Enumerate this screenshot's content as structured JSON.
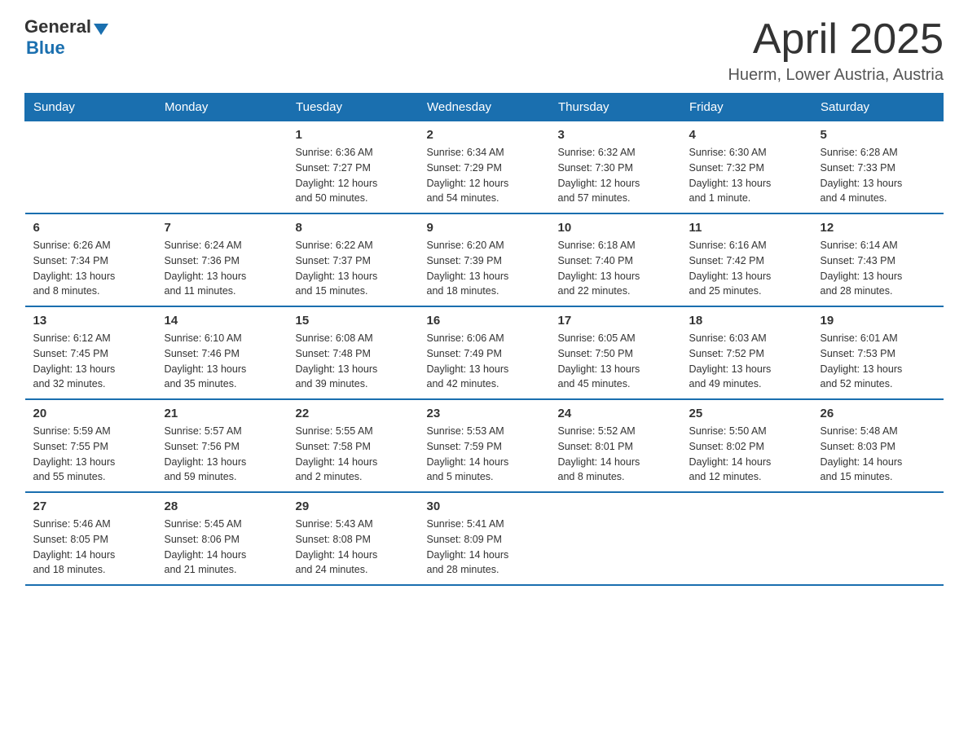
{
  "header": {
    "logo": {
      "general": "General",
      "blue": "Blue",
      "triangle_color": "#1a6faf"
    },
    "title": "April 2025",
    "subtitle": "Huerm, Lower Austria, Austria"
  },
  "calendar": {
    "weekdays": [
      "Sunday",
      "Monday",
      "Tuesday",
      "Wednesday",
      "Thursday",
      "Friday",
      "Saturday"
    ],
    "weeks": [
      [
        {
          "day": "",
          "info": ""
        },
        {
          "day": "",
          "info": ""
        },
        {
          "day": "1",
          "info": "Sunrise: 6:36 AM\nSunset: 7:27 PM\nDaylight: 12 hours\nand 50 minutes."
        },
        {
          "day": "2",
          "info": "Sunrise: 6:34 AM\nSunset: 7:29 PM\nDaylight: 12 hours\nand 54 minutes."
        },
        {
          "day": "3",
          "info": "Sunrise: 6:32 AM\nSunset: 7:30 PM\nDaylight: 12 hours\nand 57 minutes."
        },
        {
          "day": "4",
          "info": "Sunrise: 6:30 AM\nSunset: 7:32 PM\nDaylight: 13 hours\nand 1 minute."
        },
        {
          "day": "5",
          "info": "Sunrise: 6:28 AM\nSunset: 7:33 PM\nDaylight: 13 hours\nand 4 minutes."
        }
      ],
      [
        {
          "day": "6",
          "info": "Sunrise: 6:26 AM\nSunset: 7:34 PM\nDaylight: 13 hours\nand 8 minutes."
        },
        {
          "day": "7",
          "info": "Sunrise: 6:24 AM\nSunset: 7:36 PM\nDaylight: 13 hours\nand 11 minutes."
        },
        {
          "day": "8",
          "info": "Sunrise: 6:22 AM\nSunset: 7:37 PM\nDaylight: 13 hours\nand 15 minutes."
        },
        {
          "day": "9",
          "info": "Sunrise: 6:20 AM\nSunset: 7:39 PM\nDaylight: 13 hours\nand 18 minutes."
        },
        {
          "day": "10",
          "info": "Sunrise: 6:18 AM\nSunset: 7:40 PM\nDaylight: 13 hours\nand 22 minutes."
        },
        {
          "day": "11",
          "info": "Sunrise: 6:16 AM\nSunset: 7:42 PM\nDaylight: 13 hours\nand 25 minutes."
        },
        {
          "day": "12",
          "info": "Sunrise: 6:14 AM\nSunset: 7:43 PM\nDaylight: 13 hours\nand 28 minutes."
        }
      ],
      [
        {
          "day": "13",
          "info": "Sunrise: 6:12 AM\nSunset: 7:45 PM\nDaylight: 13 hours\nand 32 minutes."
        },
        {
          "day": "14",
          "info": "Sunrise: 6:10 AM\nSunset: 7:46 PM\nDaylight: 13 hours\nand 35 minutes."
        },
        {
          "day": "15",
          "info": "Sunrise: 6:08 AM\nSunset: 7:48 PM\nDaylight: 13 hours\nand 39 minutes."
        },
        {
          "day": "16",
          "info": "Sunrise: 6:06 AM\nSunset: 7:49 PM\nDaylight: 13 hours\nand 42 minutes."
        },
        {
          "day": "17",
          "info": "Sunrise: 6:05 AM\nSunset: 7:50 PM\nDaylight: 13 hours\nand 45 minutes."
        },
        {
          "day": "18",
          "info": "Sunrise: 6:03 AM\nSunset: 7:52 PM\nDaylight: 13 hours\nand 49 minutes."
        },
        {
          "day": "19",
          "info": "Sunrise: 6:01 AM\nSunset: 7:53 PM\nDaylight: 13 hours\nand 52 minutes."
        }
      ],
      [
        {
          "day": "20",
          "info": "Sunrise: 5:59 AM\nSunset: 7:55 PM\nDaylight: 13 hours\nand 55 minutes."
        },
        {
          "day": "21",
          "info": "Sunrise: 5:57 AM\nSunset: 7:56 PM\nDaylight: 13 hours\nand 59 minutes."
        },
        {
          "day": "22",
          "info": "Sunrise: 5:55 AM\nSunset: 7:58 PM\nDaylight: 14 hours\nand 2 minutes."
        },
        {
          "day": "23",
          "info": "Sunrise: 5:53 AM\nSunset: 7:59 PM\nDaylight: 14 hours\nand 5 minutes."
        },
        {
          "day": "24",
          "info": "Sunrise: 5:52 AM\nSunset: 8:01 PM\nDaylight: 14 hours\nand 8 minutes."
        },
        {
          "day": "25",
          "info": "Sunrise: 5:50 AM\nSunset: 8:02 PM\nDaylight: 14 hours\nand 12 minutes."
        },
        {
          "day": "26",
          "info": "Sunrise: 5:48 AM\nSunset: 8:03 PM\nDaylight: 14 hours\nand 15 minutes."
        }
      ],
      [
        {
          "day": "27",
          "info": "Sunrise: 5:46 AM\nSunset: 8:05 PM\nDaylight: 14 hours\nand 18 minutes."
        },
        {
          "day": "28",
          "info": "Sunrise: 5:45 AM\nSunset: 8:06 PM\nDaylight: 14 hours\nand 21 minutes."
        },
        {
          "day": "29",
          "info": "Sunrise: 5:43 AM\nSunset: 8:08 PM\nDaylight: 14 hours\nand 24 minutes."
        },
        {
          "day": "30",
          "info": "Sunrise: 5:41 AM\nSunset: 8:09 PM\nDaylight: 14 hours\nand 28 minutes."
        },
        {
          "day": "",
          "info": ""
        },
        {
          "day": "",
          "info": ""
        },
        {
          "day": "",
          "info": ""
        }
      ]
    ]
  }
}
